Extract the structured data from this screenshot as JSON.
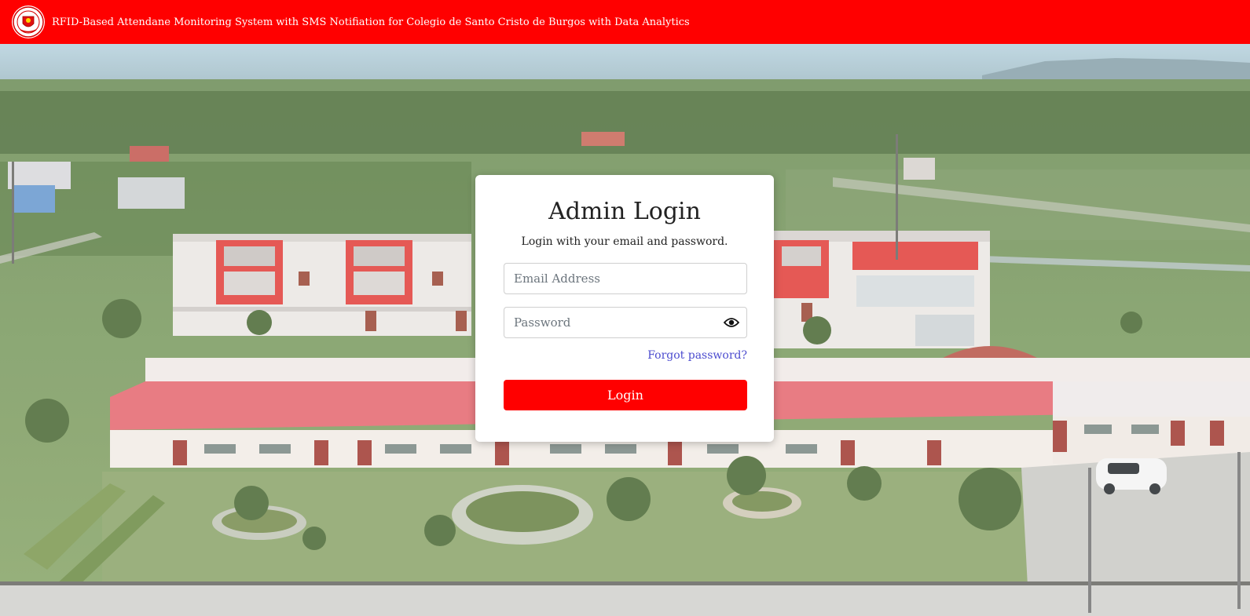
{
  "header": {
    "title": "RFID-Based Attendane Monitoring System with SMS Notifiation for Colegio de Santo Cristo de Burgos with Data Analytics",
    "logo_icon": "school-seal-icon",
    "background_color": "#ff0000"
  },
  "login": {
    "title": "Admin Login",
    "subtitle": "Login with your email and password.",
    "email_placeholder": "Email Address",
    "password_placeholder": "Password",
    "password_toggle_icon": "eye-icon",
    "forgot_password_label": "Forgot password?",
    "submit_label": "Login",
    "accent_color": "#ff0000",
    "link_color": "#4c4ccf"
  }
}
